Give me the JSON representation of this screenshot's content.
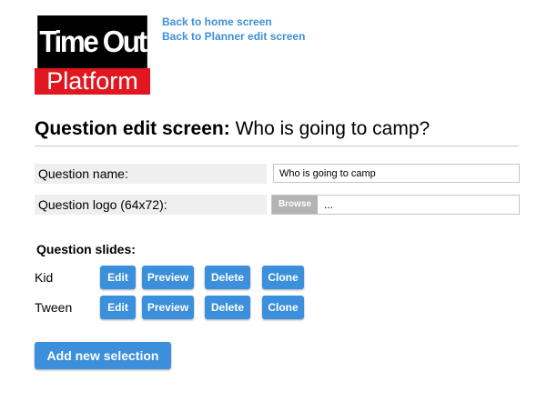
{
  "logo": {
    "top_text": "Time Out",
    "bottom_text": "Platform"
  },
  "links": {
    "home": "Back to home screen",
    "planner": "Back to Planner edit screen"
  },
  "title": {
    "prefix": "Question edit screen:",
    "question": "Who is going to camp?"
  },
  "form": {
    "name_label": "Question name:",
    "name_value": "Who is going to camp",
    "logo_label": "Question logo (64x72):",
    "browse_label": "Browse",
    "file_value": "..."
  },
  "slides": {
    "heading": "Question slides:",
    "items": [
      {
        "name": "Kid",
        "edit": "Edit",
        "preview": "Preview",
        "delete": "Delete",
        "clone": "Clone"
      },
      {
        "name": "Tween",
        "edit": "Edit",
        "preview": "Preview",
        "delete": "Delete",
        "clone": "Clone"
      }
    ]
  },
  "add_button": "Add new selection",
  "colors": {
    "link": "#3f8fd6",
    "button": "#3b8fdb",
    "logo_red": "#e1161e",
    "logo_black": "#000000"
  }
}
